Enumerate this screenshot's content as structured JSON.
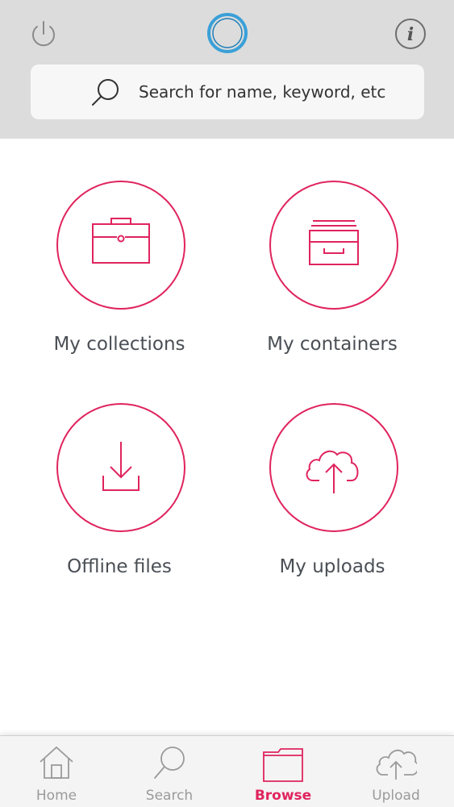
{
  "header": {
    "search_placeholder": "Search for name, keyword, etc",
    "icons": [
      "power-icon",
      "app-logo-ring",
      "info-icon"
    ]
  },
  "tiles": [
    {
      "label": "My collections",
      "icon": "briefcase-icon"
    },
    {
      "label": "My containers",
      "icon": "tray-icon"
    },
    {
      "label": "Offline files",
      "icon": "download-icon"
    },
    {
      "label": "My uploads",
      "icon": "cloud-upload-icon"
    }
  ],
  "tabbar": {
    "active": "Browse",
    "tabs": [
      {
        "label": "Home",
        "icon": "home-icon"
      },
      {
        "label": "Search",
        "icon": "search-icon"
      },
      {
        "label": "Browse",
        "icon": "folder-icon"
      },
      {
        "label": "Upload",
        "icon": "cloud-upload-icon"
      }
    ]
  },
  "colors": {
    "accent": "#e0245e",
    "header_bg": "#dcdcdc",
    "logo_ring": "#3aa0d8",
    "inactive": "#9a9a9a"
  }
}
